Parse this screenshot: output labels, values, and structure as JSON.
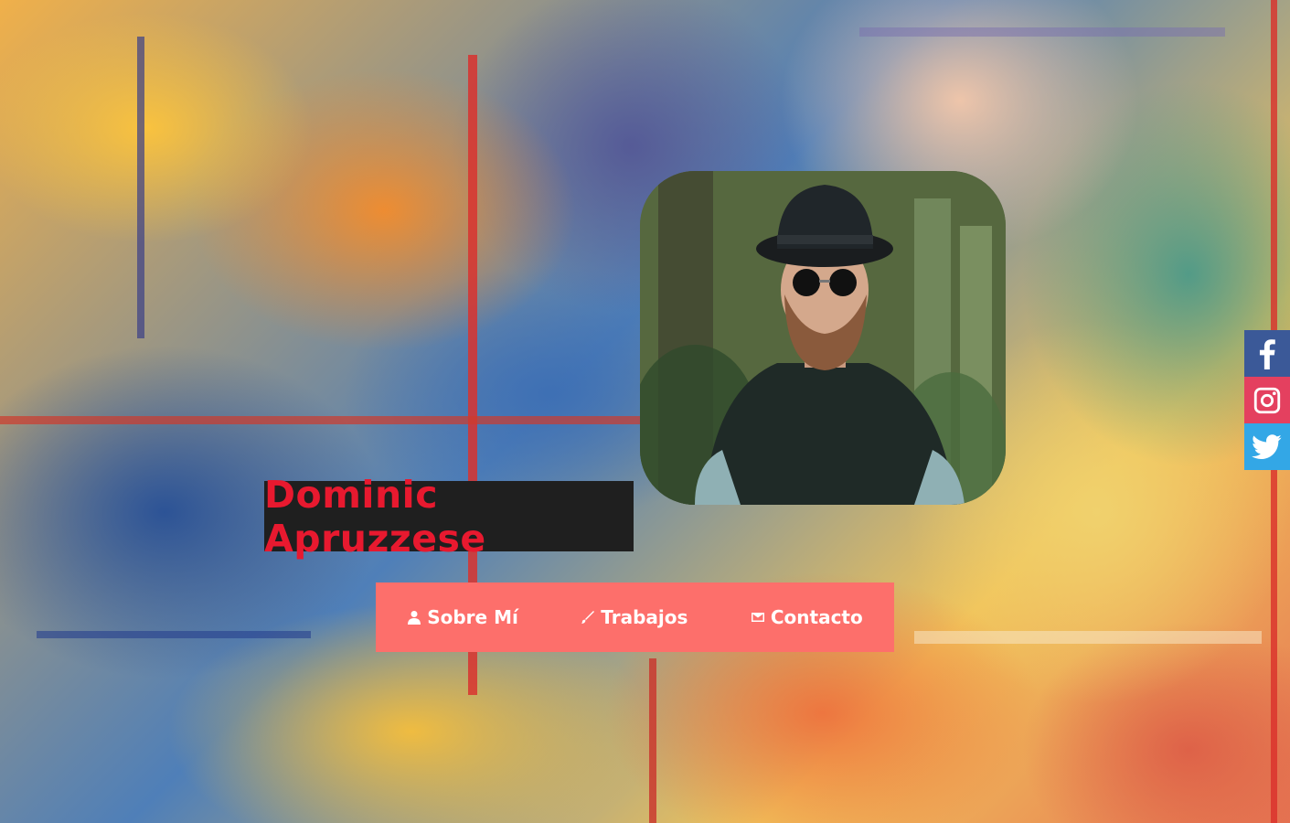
{
  "profile": {
    "name": "Dominic Apruzzese"
  },
  "nav": {
    "items": [
      {
        "icon": "person-icon",
        "label": "Sobre Mí"
      },
      {
        "icon": "brush-icon",
        "label": "Trabajos"
      },
      {
        "icon": "mail-icon",
        "label": "Contacto"
      }
    ]
  },
  "social": {
    "items": [
      {
        "icon": "facebook-icon",
        "color": "#3b5998"
      },
      {
        "icon": "instagram-icon",
        "color": "#e4405f"
      },
      {
        "icon": "twitter-icon",
        "color": "#33a7e6"
      }
    ]
  },
  "colors": {
    "name_text": "#e8192f",
    "name_bg": "#1f1f1f",
    "nav_bg": "#fd6f6b"
  }
}
